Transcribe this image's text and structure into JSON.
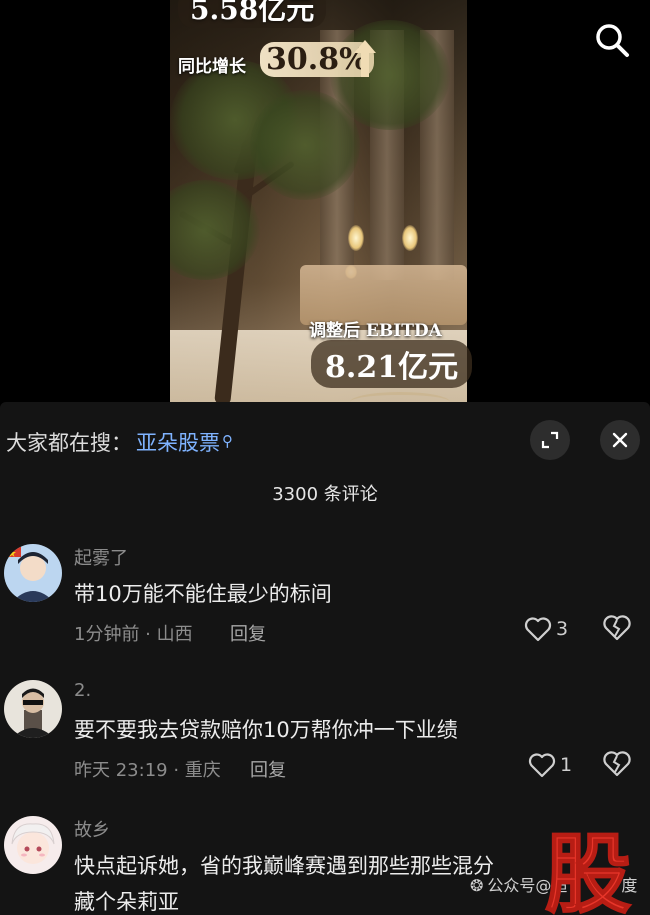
{
  "video": {
    "stat_top": "5.58亿元",
    "yoy_label": "同比增长",
    "yoy_value": "30.8%",
    "ebitda_label": "调整后 EBITDA",
    "ebitda_value": "8.21亿元",
    "search_icon": "search-icon"
  },
  "panel": {
    "suggest_label": "大家都在搜：",
    "suggest_link": "亚朵股票",
    "expand_icon": "expand-icon",
    "close_icon": "close-icon",
    "comment_count": "3300 条评论",
    "accent_color": "#7fb3ff"
  },
  "comments": [
    {
      "user": "起雾了",
      "text": "带10万能不能住最少的标间",
      "meta": "1分钟前 · 山西",
      "reply": "回复",
      "likes": "3"
    },
    {
      "user": "2.",
      "text": "要不要我去贷款赔你10万帮你冲一下业绩",
      "meta": "昨天 23:19 · 重庆",
      "reply": "回复",
      "likes": "1"
    },
    {
      "user": "故乡",
      "text_line1": "快点起诉她，省的我巅峰赛遇到那些那些混分",
      "text_line2": "藏个朵莉亚"
    }
  ],
  "watermark": {
    "source": "公众号@超",
    "tail": "度",
    "logo_char": "股"
  }
}
